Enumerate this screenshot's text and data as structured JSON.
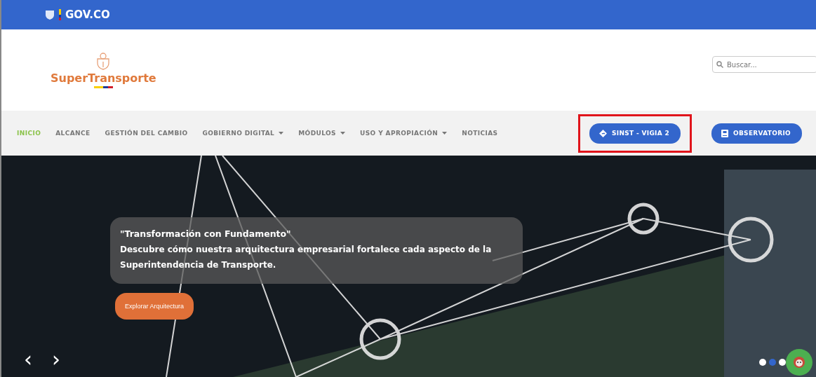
{
  "gov_bar": {
    "label": "GOV.CO"
  },
  "header": {
    "logo_text": "SuperTransporte",
    "search": {
      "placeholder": "Buscar..."
    }
  },
  "nav": {
    "items": [
      {
        "label": "INICIO",
        "selected": true,
        "dropdown": false
      },
      {
        "label": "ALCANCE",
        "selected": false,
        "dropdown": false
      },
      {
        "label": "GESTIÓN DEL CAMBIO",
        "selected": false,
        "dropdown": false
      },
      {
        "label": "GOBIERNO DIGITAL",
        "selected": false,
        "dropdown": true
      },
      {
        "label": "MÓDULOS",
        "selected": false,
        "dropdown": true
      },
      {
        "label": "USO Y APROPIACIÓN",
        "selected": false,
        "dropdown": true
      },
      {
        "label": "NOTICIAS",
        "selected": false,
        "dropdown": false
      }
    ],
    "buttons": [
      {
        "label": "SINST - VIGIA 2",
        "kind": "directions",
        "highlighted": true
      },
      {
        "label": "OBSERVATORIO",
        "kind": "book",
        "highlighted": false
      }
    ]
  },
  "hero": {
    "title": "\"Transformación con Fundamento\"",
    "text": "Descubre cómo nuestra arquitectura empresarial fortalece cada aspecto de la Superintendencia de Transporte.",
    "button": "Explorar Arquitectura",
    "prev": "‹",
    "next": "›",
    "dots": [
      {
        "selected": false
      },
      {
        "selected": true
      },
      {
        "selected": false
      }
    ]
  }
}
